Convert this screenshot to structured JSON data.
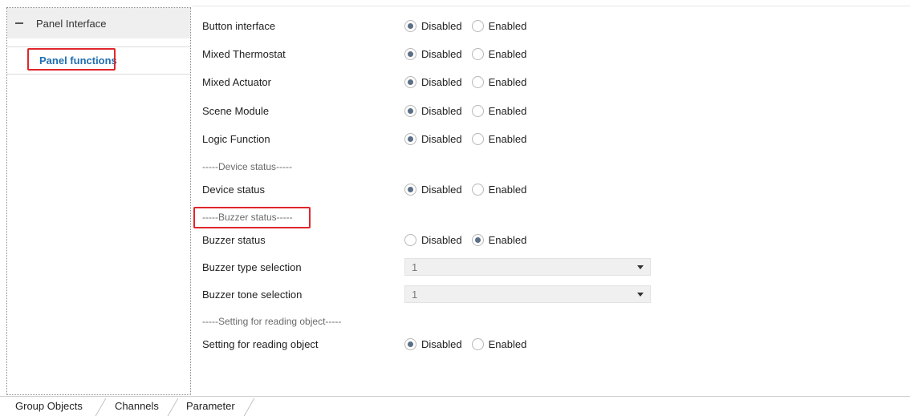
{
  "tree": {
    "root_label": "Panel Interface",
    "child_label": "Panel functions"
  },
  "options": {
    "disabled": "Disabled",
    "enabled": "Enabled"
  },
  "params": [
    {
      "label": "Button interface",
      "value": "Disabled"
    },
    {
      "label": "Mixed Thermostat",
      "value": "Disabled"
    },
    {
      "label": "Mixed Actuator",
      "value": "Disabled"
    },
    {
      "label": "Scene Module",
      "value": "Disabled"
    },
    {
      "label": "Logic Function",
      "value": "Disabled"
    },
    {
      "label": "Device status",
      "value": "Disabled"
    },
    {
      "label": "Buzzer status",
      "value": "Enabled"
    },
    {
      "label": "Buzzer type selection",
      "value": "1"
    },
    {
      "label": "Buzzer tone selection",
      "value": "1"
    },
    {
      "label": "Setting for reading object",
      "value": "Disabled"
    }
  ],
  "sections": {
    "device_status": "-----Device status-----",
    "buzzer_status": "-----Buzzer  status-----",
    "reading_object": "-----Setting for reading object-----"
  },
  "tabs": [
    "Group Objects",
    "Channels",
    "Parameter"
  ],
  "colors": {
    "highlight": "#e0262b",
    "link": "#1f6fb2"
  }
}
